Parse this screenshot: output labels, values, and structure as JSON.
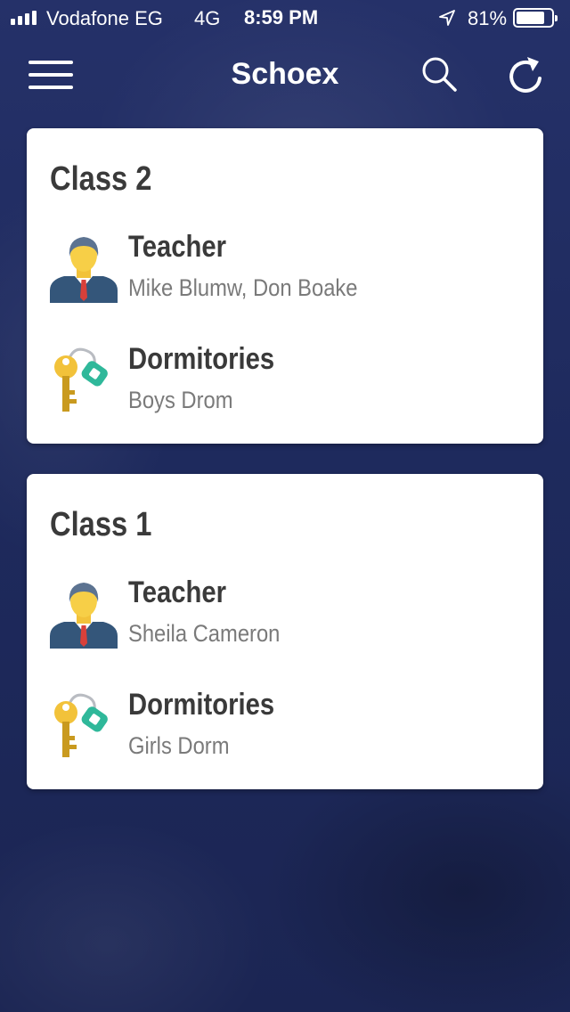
{
  "status": {
    "carrier": "Vodafone EG",
    "network": "4G",
    "time": "8:59 PM",
    "battery_percent": "81%",
    "battery_level": 0.81
  },
  "header": {
    "title": "Schoex",
    "menu_icon": "hamburger-menu-icon",
    "search_icon": "search-icon",
    "refresh_icon": "refresh-icon"
  },
  "classes": [
    {
      "name": "Class 2",
      "teacher_label": "Teacher",
      "teacher_value": "Mike Blumw, Don Boake",
      "dorm_label": "Dormitories",
      "dorm_value": "Boys Drom"
    },
    {
      "name": "Class 1",
      "teacher_label": "Teacher",
      "teacher_value": "Sheila Cameron",
      "dorm_label": "Dormitories",
      "dorm_value": "Girls Dorm"
    }
  ],
  "colors": {
    "background": "#1f2a5c",
    "card": "#ffffff",
    "title_text": "#3a3a3a",
    "secondary_text": "#7a7a7a"
  }
}
